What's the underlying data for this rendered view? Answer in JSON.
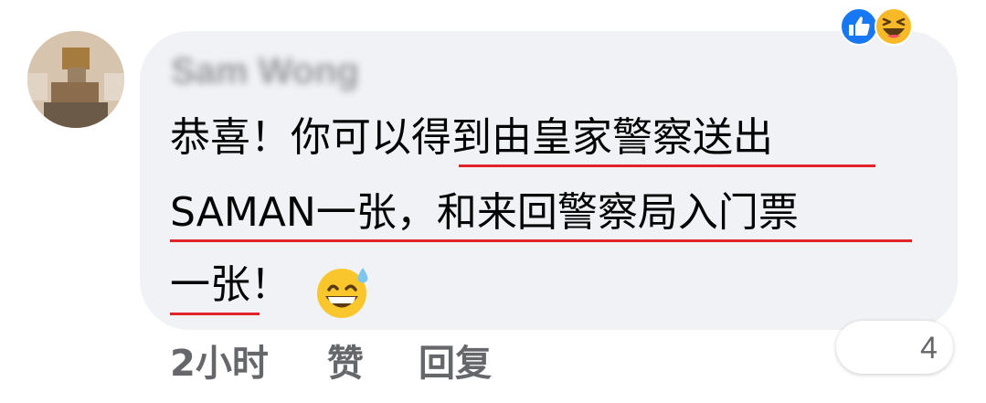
{
  "comment": {
    "author_name": "Sam Wong",
    "text_lines": [
      "恭喜！你可以得到由皇家警察送出",
      "SAMAN一张，和来回警察局入门票",
      "一张！"
    ],
    "emoji": "grinning-face-with-sweat",
    "underline_color": "#e0242a"
  },
  "footer": {
    "timestamp": "2小时",
    "like_label": "赞",
    "reply_label": "回复"
  },
  "reactions": {
    "icons": [
      "like-icon",
      "haha-icon"
    ],
    "count": "4",
    "like_color": "#1877f2",
    "haha_color": "#f7b928"
  },
  "colors": {
    "bubble_bg": "#f0f2f5",
    "text": "#050505",
    "meta_text": "#65676b"
  }
}
